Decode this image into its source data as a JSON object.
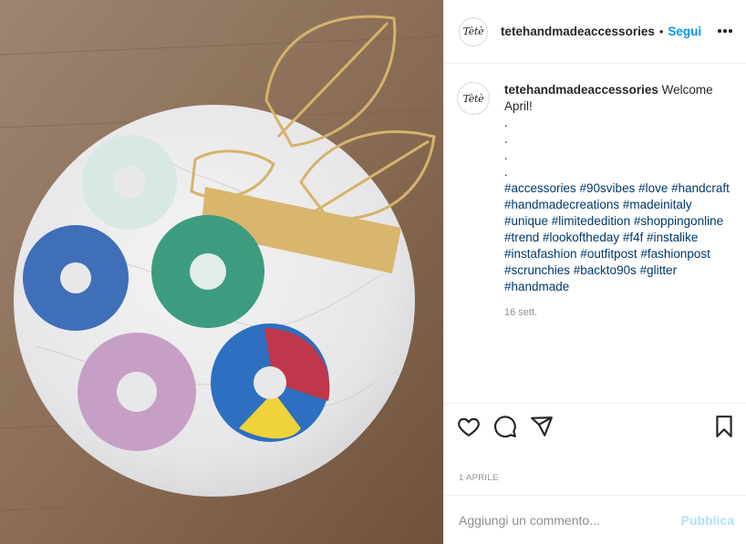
{
  "post": {
    "username": "tetehandmadeaccessories",
    "avatar_text": "Tètè",
    "follow_label": "Segui",
    "more_icon": "more-horizontal-icon",
    "image_alt": "Scrunchies on a marble table with a gold leaf ornament"
  },
  "caption": {
    "username": "tetehandmadeaccessories",
    "text": "Welcome April!",
    "dots": [
      ".",
      ".",
      ".",
      "."
    ],
    "hashtags": "#accessories #90svibes #love #handcraft #handmadecreations #madeinitaly #unique #limitededition #shoppingonline #trend #lookoftheday #f4f #instalike #instafashion #outfitpost #fashionpost #scrunchies #backto90s #glitter #handmade",
    "time": "16 sett."
  },
  "actions": {
    "like_icon": "heart-icon",
    "comment_icon": "comment-icon",
    "share_icon": "share-icon",
    "save_icon": "bookmark-icon"
  },
  "date": "1 APRILE",
  "comment_box": {
    "placeholder": "Aggiungi un commento...",
    "publish_label": "Pubblica"
  },
  "colors": {
    "link": "#00376b",
    "follow": "#0095f6",
    "publish_disabled": "#b2dffc",
    "muted": "#8e8e8e"
  }
}
